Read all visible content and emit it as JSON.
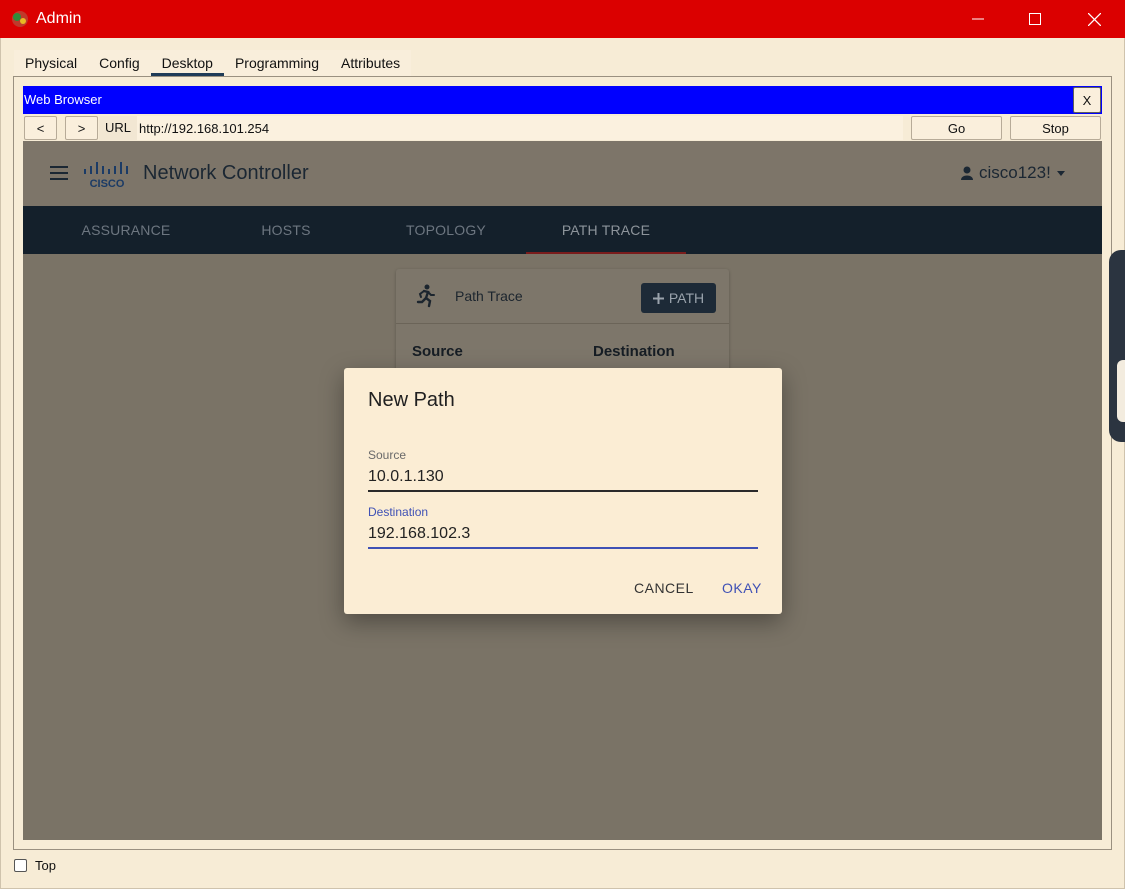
{
  "window": {
    "title": "Admin",
    "controls": {
      "minimize": "—",
      "maximize": "☐",
      "close": "✕"
    }
  },
  "tabs": [
    {
      "label": "Physical"
    },
    {
      "label": "Config"
    },
    {
      "label": "Desktop",
      "active": true
    },
    {
      "label": "Programming"
    },
    {
      "label": "Attributes"
    }
  ],
  "browser": {
    "title": "Web Browser",
    "close_label": "X",
    "back_label": "<",
    "forward_label": ">",
    "url_label": "URL",
    "url": "http://192.168.101.254",
    "go_label": "Go",
    "stop_label": "Stop"
  },
  "webpage": {
    "brand": "Network Controller",
    "logo_text": "CISCO",
    "user": "cisco123!",
    "nav": [
      {
        "label": "ASSURANCE"
      },
      {
        "label": "HOSTS"
      },
      {
        "label": "TOPOLOGY"
      },
      {
        "label": "PATH TRACE",
        "active": true
      }
    ],
    "card": {
      "title": "Path Trace",
      "add_button": "PATH",
      "columns": [
        "Source",
        "Destination"
      ]
    }
  },
  "dialog": {
    "title": "New Path",
    "source_label": "Source",
    "source_value": "10.0.1.130",
    "destination_label": "Destination",
    "destination_value": "192.168.102.3",
    "cancel": "CANCEL",
    "okay": "OKAY"
  },
  "footer": {
    "top_label": "Top",
    "top_checked": false
  },
  "colors": {
    "titlebar": "#db0000",
    "browser_title": "#0000ff",
    "nav_bar": "#14202b",
    "accent": "#3f51b5"
  }
}
